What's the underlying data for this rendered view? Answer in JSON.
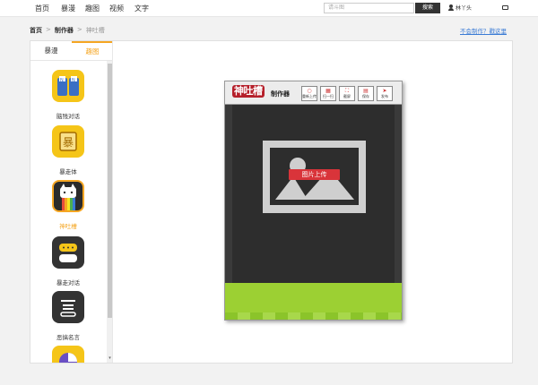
{
  "nav": {
    "items": [
      "首页",
      "暴漫",
      "趣图",
      "视频",
      "文字"
    ],
    "search_placeholder": "请斗图",
    "search_button": "搜索",
    "username": "林丫头"
  },
  "breadcrumb": {
    "home": "首页",
    "section": "制作器",
    "current": "神吐槽",
    "separator": ">"
  },
  "help_link": "不会制作？戳这里",
  "sidebar": {
    "tabs": [
      "暴漫",
      "趣图"
    ],
    "active_tab": 1,
    "tools": [
      {
        "label": "脑残对话",
        "icon": "brain-chat-icon",
        "color": "#f5c518"
      },
      {
        "label": "暴走体",
        "icon": "rage-font-icon",
        "color": "#f5c518"
      },
      {
        "label": "神吐槽",
        "icon": "cat-rainbow-icon",
        "color": "#f5a623",
        "active": true
      },
      {
        "label": "暴走对话",
        "icon": "chat-bubble-icon",
        "color": "#333333"
      },
      {
        "label": "恶搞名言",
        "icon": "quote-icon",
        "color": "#333333"
      },
      {
        "label": "",
        "icon": "pie-icon",
        "color": "#f5c518"
      }
    ]
  },
  "editor": {
    "logo_main": "神吐槽",
    "logo_sub": "制作器",
    "header_buttons": [
      {
        "label": "重新上传",
        "icon": "refresh-icon"
      },
      {
        "label": "扫一扫",
        "icon": "qr-icon"
      },
      {
        "label": "截屏",
        "icon": "crop-icon"
      },
      {
        "label": "保存",
        "icon": "save-icon"
      },
      {
        "label": "发布",
        "icon": "send-icon"
      }
    ],
    "upload_label": "图片上传"
  },
  "colors": {
    "accent": "#f5a623",
    "upload_button": "#d9343a",
    "logo_red": "#b51f2a",
    "footer_green": "#9cd033",
    "link_blue": "#3a7bd5"
  }
}
